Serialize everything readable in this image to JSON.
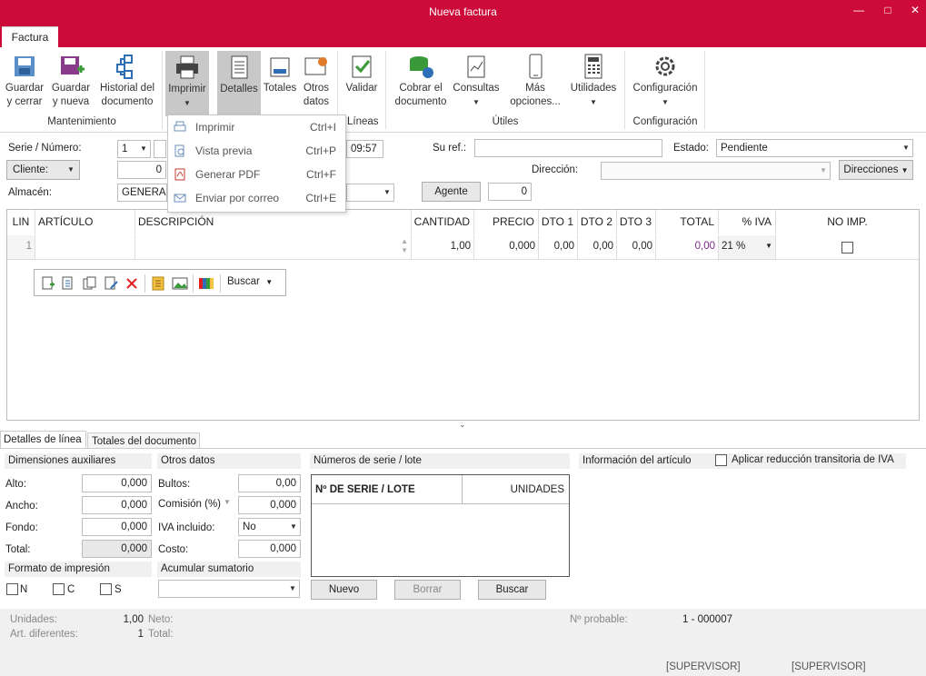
{
  "window": {
    "title": "Nueva factura",
    "tab": "Factura"
  },
  "ribbon": {
    "guardar_cerrar": "Guardar\ny cerrar",
    "guardar_nueva": "Guardar\ny nueva",
    "historial": "Historial del\ndocumento",
    "imprimir": "Imprimir",
    "detalles": "Detalles",
    "totales": "Totales",
    "otros_datos": "Otros\ndatos",
    "validar": "Validar",
    "cobrar": "Cobrar el\ndocumento",
    "consultas": "Consultas",
    "mas_opciones": "Más\nopciones...",
    "utilidades": "Utilidades",
    "configuracion": "Configuración",
    "group_mantenimiento": "Mantenimiento",
    "group_lineas": "Líneas",
    "group_utiles": "Útiles",
    "group_configuracion": "Configuración"
  },
  "print_menu": [
    {
      "label": "Imprimir",
      "shortcut": "Ctrl+I",
      "icon": "printer-icon"
    },
    {
      "label": "Vista previa",
      "shortcut": "Ctrl+P",
      "icon": "preview-icon"
    },
    {
      "label": "Generar PDF",
      "shortcut": "Ctrl+F",
      "icon": "pdf-icon"
    },
    {
      "label": "Enviar por correo",
      "shortcut": "Ctrl+E",
      "icon": "mail-icon"
    }
  ],
  "header": {
    "serie_label": "Serie / Número:",
    "serie_value": "1",
    "time": "09:57",
    "su_ref_label": "Su ref.:",
    "su_ref_value": "",
    "estado_label": "Estado:",
    "estado_value": "Pendiente",
    "cliente_label": "Cliente:",
    "cliente_code": "0",
    "direccion_label": "Dirección:",
    "direcciones_btn": "Direcciones",
    "almacen_label": "Almacén:",
    "almacen_value": "GENERAL",
    "agente_btn": "Agente",
    "agente_value": "0"
  },
  "grid": {
    "columns": [
      "LIN",
      "ARTÍCULO",
      "DESCRIPCIÓN",
      "CANTIDAD",
      "PRECIO",
      "DTO 1",
      "DTO 2",
      "DTO 3",
      "TOTAL",
      "% IVA",
      "NO IMP."
    ],
    "row": {
      "lin": "1",
      "articulo": "",
      "descripcion": "",
      "cantidad": "1,00",
      "precio": "0,000",
      "dto1": "0,00",
      "dto2": "0,00",
      "dto3": "0,00",
      "total": "0,00",
      "iva": "21 %"
    },
    "search_label": "Buscar"
  },
  "bottom_tabs": [
    "Detalles de línea",
    "Totales del documento"
  ],
  "dimensiones": {
    "title": "Dimensiones auxiliares",
    "alto_label": "Alto:",
    "alto": "0,000",
    "ancho_label": "Ancho:",
    "ancho": "0,000",
    "fondo_label": "Fondo:",
    "fondo": "0,000",
    "total_label": "Total:",
    "total": "0,000"
  },
  "otros": {
    "title": "Otros datos",
    "bultos_label": "Bultos:",
    "bultos": "0,00",
    "comision_label": "Comisión (%)",
    "comision": "0,000",
    "iva_incl_label": "IVA incluido:",
    "iva_incl": "No",
    "coste_label": "Costo:",
    "coste": "0,000"
  },
  "formato": {
    "title": "Formato de impresión",
    "n": "N",
    "c": "C",
    "s": "S"
  },
  "acumular": {
    "title": "Acumular sumatorio"
  },
  "serie_lote": {
    "title": "Números de serie / lote",
    "col1": "Nº DE SERIE / LOTE",
    "col2": "UNIDADES",
    "nuevo": "Nuevo",
    "borrar": "Borrar",
    "buscar": "Buscar"
  },
  "info_articulo": {
    "title": "Información del artículo",
    "reduccion": "Aplicar reducción transitoria de IVA"
  },
  "status": {
    "unidades_label": "Unidades:",
    "unidades": "1,00",
    "neto_label": "Neto:",
    "art_dif_label": "Art. diferentes:",
    "art_dif": "1",
    "total_label": "Total:",
    "probable_label": "Nº probable:",
    "probable": "1 - 000007",
    "user1": "[SUPERVISOR]",
    "user2": "[SUPERVISOR]"
  },
  "colors": {
    "titlebar": "#cc0b3b",
    "accent_iva": "#7b2a87"
  }
}
